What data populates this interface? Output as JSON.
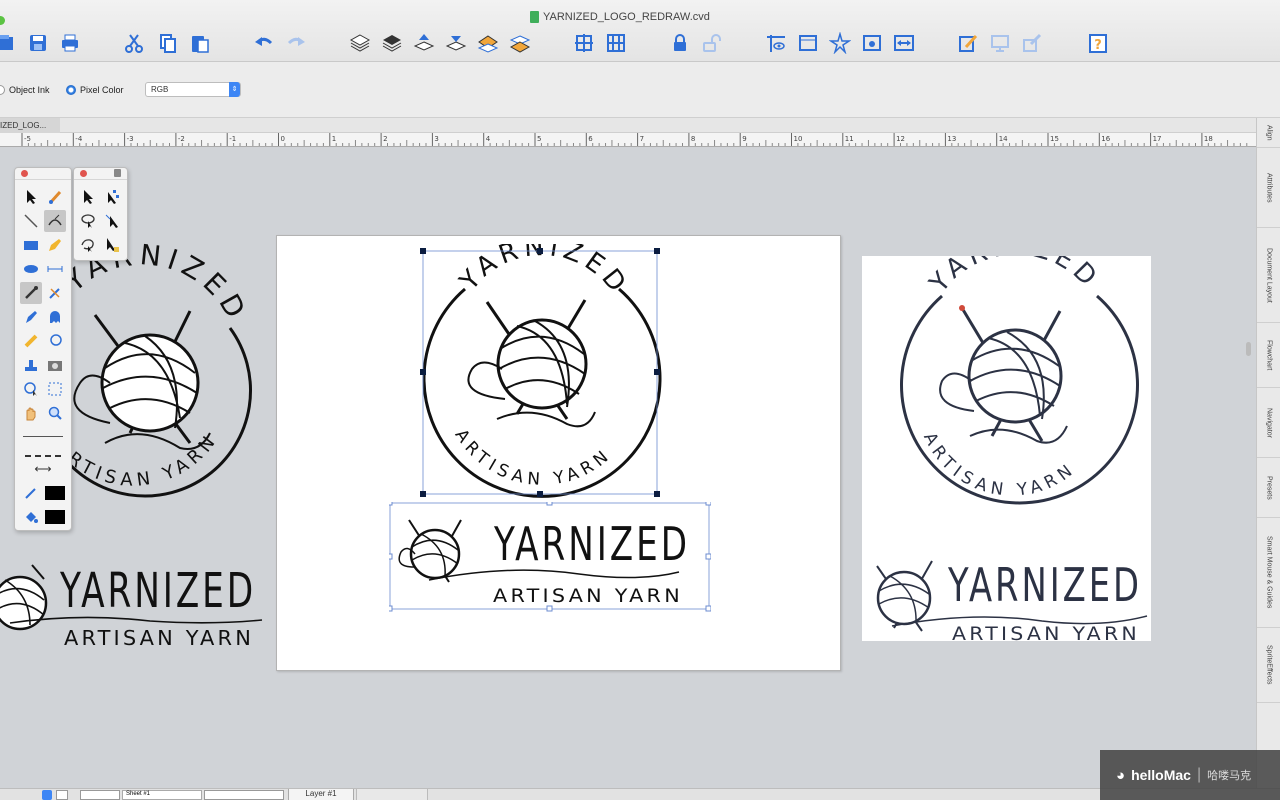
{
  "window": {
    "title": "YARNIZED_LOGO_REDRAW.cvd"
  },
  "options_bar": {
    "object_ink_label": "Object Ink",
    "pixel_color_label": "Pixel Color",
    "color_mode": "RGB"
  },
  "tab": {
    "label": "IZED_LOG..."
  },
  "ruler": {
    "labels": [
      "-5",
      "-4",
      "-3",
      "-2",
      "-1",
      "0",
      "1",
      "2",
      "3",
      "4",
      "5",
      "6",
      "7",
      "8",
      "9",
      "10",
      "11",
      "12",
      "13",
      "14",
      "15",
      "16",
      "17",
      "18"
    ]
  },
  "side_dock": {
    "tabs": [
      "Align",
      "Attributes",
      "Document Layout",
      "Flowchart",
      "Navigator",
      "Presets",
      "Smart Mouse & Guides",
      "SpriteEffects"
    ]
  },
  "logo": {
    "brand": "YARNIZED",
    "tagline": "ARTISAN YARN"
  },
  "status_bar": {
    "sheet": "Sheet #1",
    "layer": "Layer #1"
  },
  "watermark": {
    "brand": "helloMac",
    "chinese": "哈喽马克"
  },
  "colors": {
    "accent": "#3d86f5",
    "ink": "#111111",
    "ref_ink": "#2c3244",
    "canvas": "#d0d3d7"
  }
}
